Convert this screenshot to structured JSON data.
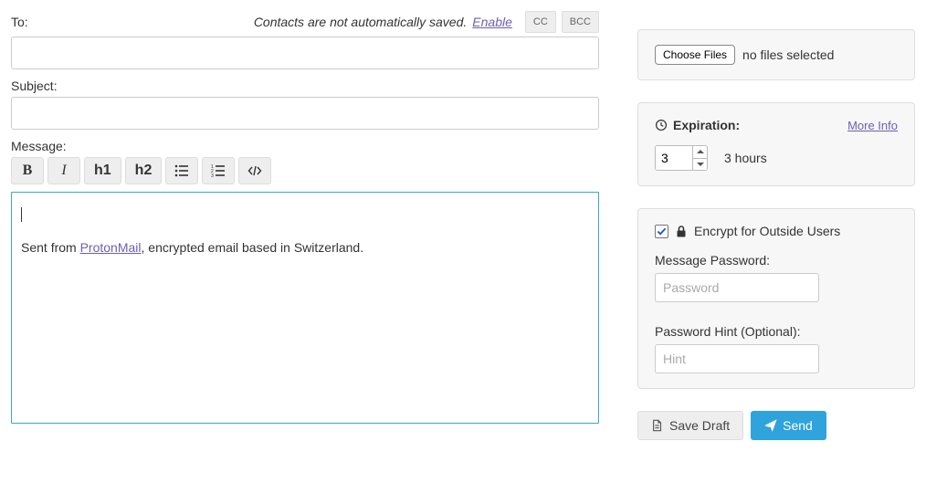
{
  "compose": {
    "to_label": "To:",
    "to_value": "",
    "contacts_note": "Contacts are not automatically saved.",
    "enable_link": "Enable",
    "cc_label": "CC",
    "bcc_label": "BCC",
    "subject_label": "Subject:",
    "subject_value": "",
    "message_label": "Message:",
    "editor": {
      "prefix": "Sent from ",
      "link_text": "ProtonMail",
      "suffix": ", encrypted email based in Switzerland."
    }
  },
  "toolbar": {
    "bold": "B",
    "italic": "I",
    "h1": "h1",
    "h2": "h2"
  },
  "attachments": {
    "choose_label": "Choose Files",
    "status": "no files selected"
  },
  "expiration": {
    "title": "Expiration:",
    "more_info": "More Info",
    "value": "3",
    "display": "3 hours"
  },
  "encrypt": {
    "checked": true,
    "title": "Encrypt for Outside Users",
    "password_label": "Message Password:",
    "password_placeholder": "Password",
    "password_value": "",
    "hint_label": "Password Hint (Optional):",
    "hint_placeholder": "Hint",
    "hint_value": ""
  },
  "actions": {
    "save_draft": "Save Draft",
    "send": "Send"
  }
}
